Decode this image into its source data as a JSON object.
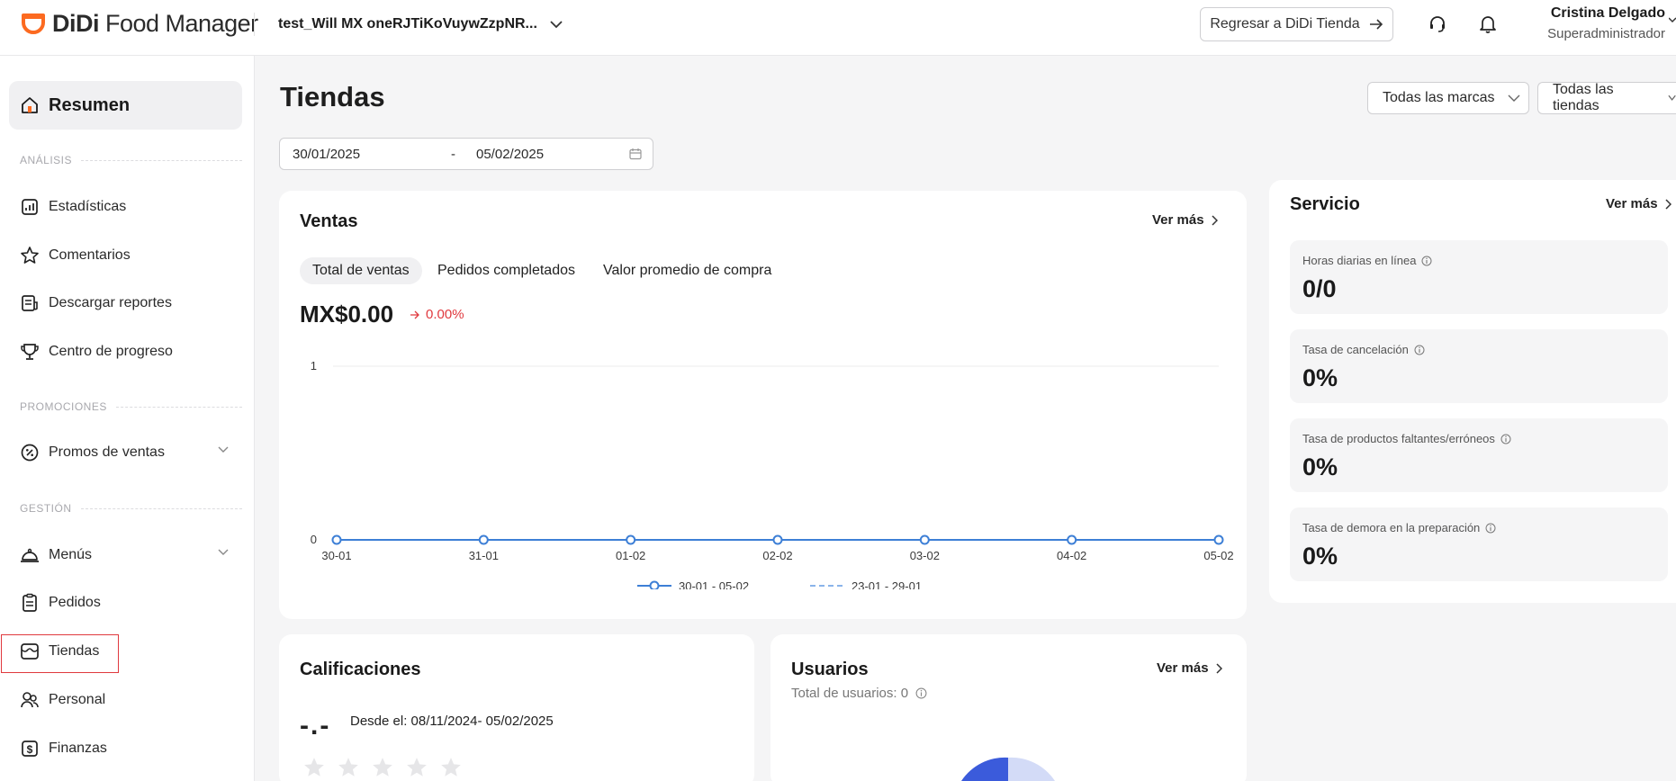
{
  "header": {
    "brand_bold": "DiDi",
    "brand_rest": " Food Manager",
    "store_name": "test_Will MX oneRJTiKoVuywZzpNR...",
    "back_button": "Regresar a DiDi Tienda",
    "user_name": "Cristina Delgado",
    "user_role": "Superadministrador"
  },
  "sidebar": {
    "active": "Resumen",
    "sections": {
      "analysis": "ANÁLISIS",
      "promotions": "PROMOCIONES",
      "management": "GESTIÓN"
    },
    "items": {
      "stats": "Estadísticas",
      "comments": "Comentarios",
      "reports": "Descargar reportes",
      "progress": "Centro de progreso",
      "promos": "Promos de ventas",
      "menus": "Menús",
      "orders": "Pedidos",
      "stores": "Tiendas",
      "staff": "Personal",
      "finance": "Finanzas"
    }
  },
  "main": {
    "title": "Tiendas",
    "brand_filter": "Todas las marcas",
    "store_filter": "Todas las tiendas",
    "date_start": "30/01/2025",
    "date_separator": "-",
    "date_end": "05/02/2025"
  },
  "sales": {
    "title": "Ventas",
    "ver_mas": "Ver más",
    "tabs": [
      "Total de ventas",
      "Pedidos completados",
      "Valor promedio de compra"
    ],
    "value": "MX$0.00",
    "delta": "0.00%"
  },
  "chart_data": {
    "type": "line",
    "categories": [
      "30-01",
      "31-01",
      "01-02",
      "02-02",
      "03-02",
      "04-02",
      "05-02"
    ],
    "series": [
      {
        "name": "30-01 - 05-02",
        "values": [
          0,
          0,
          0,
          0,
          0,
          0,
          0
        ],
        "color": "#3d7fd6",
        "style": "solid"
      },
      {
        "name": "23-01 - 29-01",
        "values": [
          0,
          0,
          0,
          0,
          0,
          0,
          0
        ],
        "color": "#8ab4ea",
        "style": "dashed"
      }
    ],
    "ylim": [
      0,
      1
    ],
    "yticks": [
      "0",
      "1"
    ],
    "grid": true,
    "legend": "bottom"
  },
  "service": {
    "title": "Servicio",
    "ver_mas": "Ver más",
    "metrics": [
      {
        "label": "Horas diarias en línea",
        "value": "0/0"
      },
      {
        "label": "Tasa de cancelación",
        "value": "0%"
      },
      {
        "label": "Tasa de productos faltantes/erróneos",
        "value": "0%"
      },
      {
        "label": "Tasa de demora en la preparación",
        "value": "0%"
      }
    ]
  },
  "ratings": {
    "title": "Calificaciones",
    "score": "-.-",
    "since": "Desde el: 08/11/2024- 05/02/2025",
    "stars": 0
  },
  "users": {
    "title": "Usuarios",
    "ver_mas": "Ver más",
    "total": "Total de usuarios: 0"
  },
  "colors": {
    "brand": "#fc6a20",
    "accent_blue": "#3d7fd6",
    "negative": "#e0393e"
  }
}
